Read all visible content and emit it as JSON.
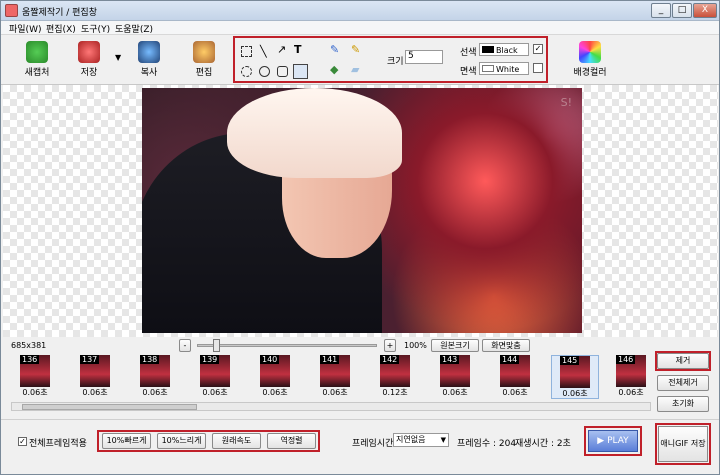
{
  "window": {
    "title": "움짤제작기 / 편집창",
    "min": "_",
    "max": "□",
    "close": "X"
  },
  "menu": [
    "파일(W)",
    "편집(X)",
    "도구(Y)",
    "도움말(Z)"
  ],
  "toolbar": {
    "new": "새캡처",
    "save": "저장",
    "copy": "복사",
    "edit": "편집",
    "bg": "배경컬러"
  },
  "drawopts": {
    "size_label": "크기",
    "size_value": "5",
    "line_label": "선색",
    "line_value": "Black",
    "fill_label": "면색",
    "fill_value": "White"
  },
  "canvas": {
    "dimensions": "685x381",
    "zoom": "100%",
    "btn_original": "원본크기",
    "btn_fit": "화면맞춤"
  },
  "frames": [
    {
      "n": "136",
      "t": "0.06초"
    },
    {
      "n": "137",
      "t": "0.06초"
    },
    {
      "n": "138",
      "t": "0.06초"
    },
    {
      "n": "139",
      "t": "0.06초"
    },
    {
      "n": "140",
      "t": "0.06초"
    },
    {
      "n": "141",
      "t": "0.06초"
    },
    {
      "n": "142",
      "t": "0.12초"
    },
    {
      "n": "143",
      "t": "0.06초"
    },
    {
      "n": "144",
      "t": "0.06초"
    },
    {
      "n": "145",
      "t": "0.06초"
    },
    {
      "n": "146",
      "t": "0.06초"
    }
  ],
  "right": {
    "remove": "제거",
    "remove_all": "전체제거",
    "reset": "초기화",
    "save_gif": "애니GIF 저장"
  },
  "bottom": {
    "apply_all": "전체프레임적용",
    "faster": "10%빠르게",
    "slower": "10%느리게",
    "original_speed": "원래속도",
    "reverse": "역정렬",
    "frame_time_label": "프레임시간",
    "frame_time_value": "지연없음",
    "frame_count": "프레임수 : 204",
    "play_time": "재생시간 : 2초",
    "play": "▶ PLAY"
  }
}
